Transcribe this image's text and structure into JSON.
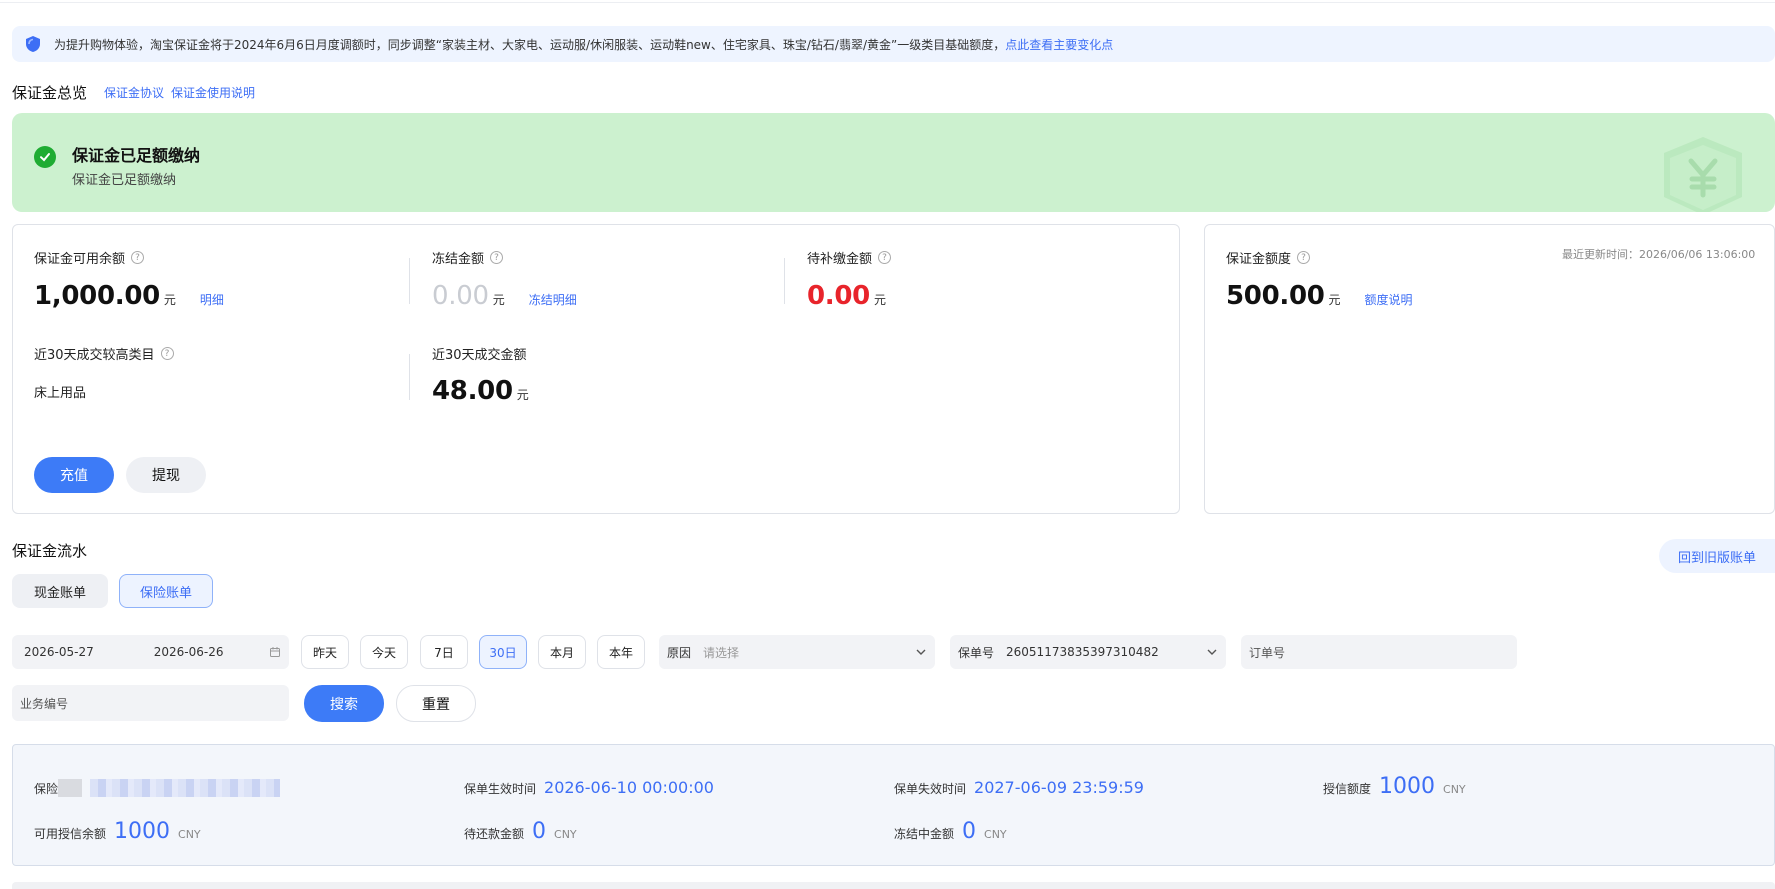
{
  "notice": {
    "text": "为提升购物体验，淘宝保证金将于2024年6月6日月度调额时，同步调整“家装主材、大家电、运动服/休闲服装、运动鞋new、住宅家具、珠宝/钻石/翡翠/黄金”一级类目基础额度，",
    "link": "点此查看主要变化点"
  },
  "overview": {
    "title": "保证金总览",
    "links": [
      "保证金协议",
      "保证金使用说明"
    ]
  },
  "banner": {
    "title": "保证金已足额缴纳",
    "subtitle": "保证金已足额缴纳",
    "icon": "shield-yuan-icon"
  },
  "balance": {
    "available": {
      "label": "保证金可用余额",
      "value": "1,000.00",
      "unit": "元",
      "link": "明细"
    },
    "frozen": {
      "label": "冻结金额",
      "value": "0.00",
      "unit": "元",
      "link": "冻结明细"
    },
    "pending": {
      "label": "待补缴金额",
      "value": "0.00",
      "unit": "元"
    },
    "top_category": {
      "label": "近30天成交较高类目",
      "value": "床上用品"
    },
    "trade_amount": {
      "label": "近30天成交金额",
      "value": "48.00",
      "unit": "元"
    },
    "recharge_label": "充值",
    "withdraw_label": "提现"
  },
  "quota": {
    "label": "保证金额度",
    "updated": "最近更新时间：2026/06/06 13:06:00",
    "value": "500.00",
    "unit": "元",
    "link": "额度说明"
  },
  "flow": {
    "title": "保证金流水",
    "old_link": "回到旧版账单",
    "tabs": [
      {
        "label": "现金账单",
        "active": false
      },
      {
        "label": "保险账单",
        "active": true
      }
    ]
  },
  "filters": {
    "date_start": "2026-05-27",
    "date_end": "2026-06-26",
    "quick": [
      {
        "label": "昨天",
        "active": false
      },
      {
        "label": "今天",
        "active": false
      },
      {
        "label": "7日",
        "active": false
      },
      {
        "label": "30日",
        "active": true
      },
      {
        "label": "本月",
        "active": false
      },
      {
        "label": "本年",
        "active": false
      }
    ],
    "reason_label": "原因",
    "reason_placeholder": "请选择",
    "policy_label": "保单号",
    "policy_value": "26051173835397310482",
    "order_placeholder": "订单号",
    "business_placeholder": "业务编号",
    "search_label": "搜索",
    "reset_label": "重置"
  },
  "insurance": {
    "company_label": "保险",
    "effective_label": "保单生效时间",
    "effective_value": "2026-06-10 00:00:00",
    "expire_label": "保单失效时间",
    "expire_value": "2027-06-09 23:59:59",
    "credit_label": "授信额度",
    "credit_value": "1000",
    "credit_unit": "CNY",
    "available_label": "可用授信余额",
    "available_value": "1000",
    "available_unit": "CNY",
    "repay_label": "待还款金额",
    "repay_value": "0",
    "repay_unit": "CNY",
    "frozen_label": "冻结中金额",
    "frozen_value": "0",
    "frozen_unit": "CNY"
  },
  "colors": {
    "accent": "#3d7bf7",
    "success_bg": "#ccf1cf",
    "danger": "#e8242b"
  }
}
